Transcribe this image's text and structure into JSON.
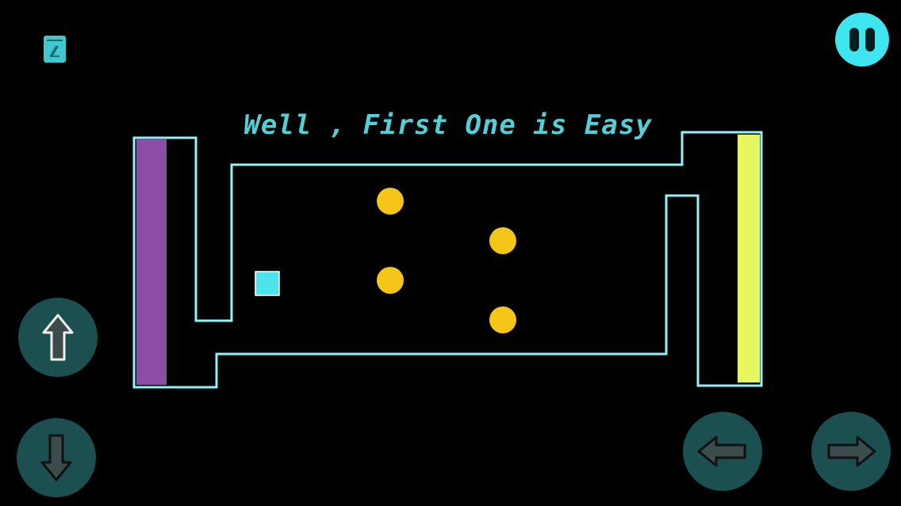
{
  "level": {
    "title": "Well , First One is Easy"
  },
  "colors": {
    "wall": "#8ff4f7",
    "start_zone": "#8c4da6",
    "goal_zone": "#e6f560",
    "coin": "#f5c518",
    "player": "#4de3ec",
    "button_bg": "#1b4f50",
    "pause_bg": "#3ee6f0",
    "title": "#55cfd6"
  },
  "icons": {
    "level": "level-indicator-icon",
    "pause": "pause-icon",
    "up": "arrow-up-icon",
    "down": "arrow-down-icon",
    "left": "arrow-left-icon",
    "right": "arrow-right-icon"
  }
}
